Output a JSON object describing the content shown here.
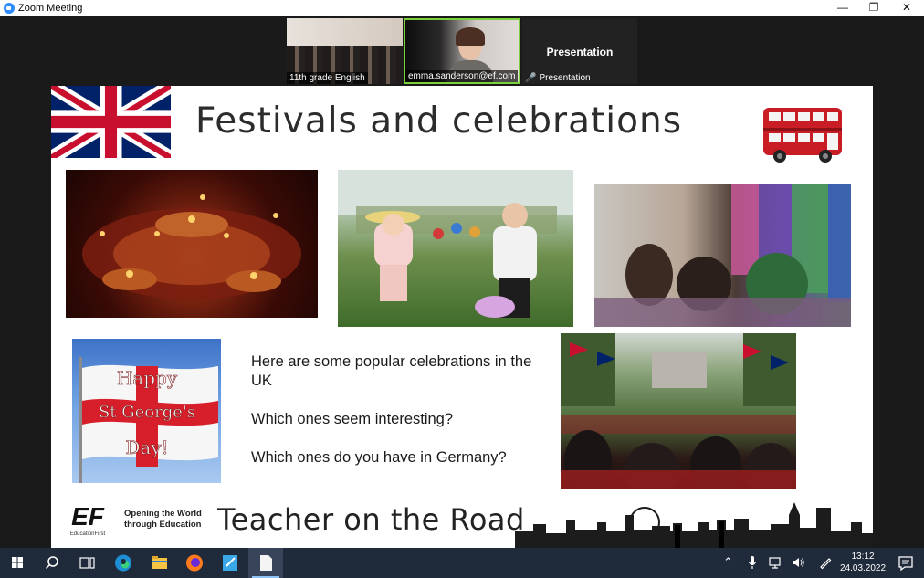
{
  "window": {
    "title": "Zoom Meeting",
    "minimize_glyph": "—",
    "maximize_glyph": "❐",
    "close_glyph": "✕"
  },
  "participants": [
    {
      "name": "11th grade English"
    },
    {
      "name": "emma.sanderson@ef.com"
    },
    {
      "name": "Presentation",
      "title": "Presentation"
    }
  ],
  "slide": {
    "title": "Festivals and celebrations",
    "flag_caption": [
      "Happy",
      "St George's",
      "Day!"
    ],
    "text_lines": [
      "Here are some popular celebrations in the UK",
      "Which ones seem interesting?",
      "Which ones do you have in Germany?"
    ],
    "logo_text": "EF",
    "logo_subtext": "EducationFirst",
    "slogan": "Opening the World through Education",
    "tagline": "Teacher on the Road"
  },
  "taskbar": {
    "icons": [
      "windows-start-icon",
      "search-icon",
      "task-view-icon",
      "edge-icon",
      "file-explorer-icon",
      "firefox-icon",
      "notepad-icon",
      "document-icon"
    ],
    "tray_icons": [
      "chevron-up-icon",
      "microphone-icon",
      "network-icon",
      "volume-icon",
      "pen-icon"
    ],
    "time": "13:12",
    "date": "24.03.2022"
  },
  "colors": {
    "zoom_blue": "#2d8cff",
    "active_speaker_border": "#7ad23a",
    "taskbar_bg": "#1f2a3a",
    "union_jack_blue": "#012169",
    "union_jack_red": "#c8102e",
    "bus_red": "#c81d25"
  }
}
